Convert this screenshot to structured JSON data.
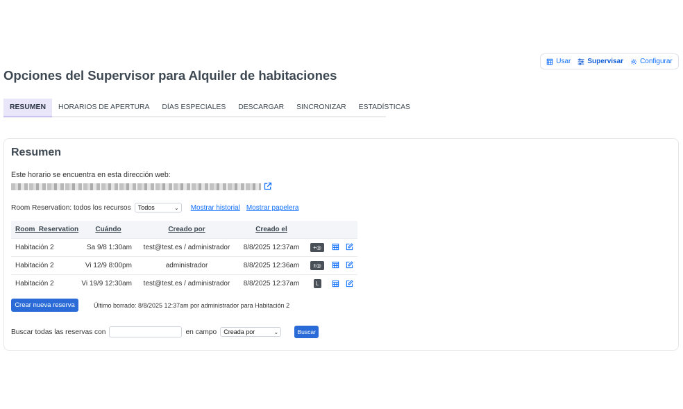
{
  "topnav": {
    "use": "Usar",
    "supervise": "Supervisar",
    "configure": "Configurar"
  },
  "page_title": "Opciones del Supervisor para Alquiler de habitaciones",
  "tabs": [
    {
      "label": "RESUMEN",
      "active": true
    },
    {
      "label": "HORARIOS DE APERTURA"
    },
    {
      "label": "DÍAS ESPECIALES"
    },
    {
      "label": "DESCARGAR"
    },
    {
      "label": "SINCRONIZAR"
    },
    {
      "label": "ESTADÍSTICAS"
    }
  ],
  "card": {
    "title": "Resumen",
    "web_intro": "Este horario se encuentra en esta dirección web:",
    "filter": {
      "label": "Room Reservation: todos los recursos",
      "selected": "Todos",
      "show_history": "Mostrar historial",
      "show_trash": "Mostrar papelera"
    },
    "table": {
      "headers": [
        "Room_Reservation",
        "Cuándo",
        "Creado por",
        "Creado el"
      ],
      "rows": [
        {
          "resource": "Habitación 2",
          "when": "Sa 9/8 1:30am",
          "created_by": "test@test.es / administrador",
          "created_at": "8/8/2025 12:37am",
          "badge": "+◎"
        },
        {
          "resource": "Habitación 2",
          "when": "Vi 12/9 8:00pm",
          "created_by": "administrador",
          "created_at": "8/8/2025 12:36am",
          "badge": "±◎"
        },
        {
          "resource": "Habitación 2",
          "when": "Vi 19/9 12:30am",
          "created_by": "test@test.es / administrador",
          "created_at": "8/8/2025 12:37am",
          "badge": "L"
        }
      ]
    },
    "new_reservation": "Crear nueva reserva",
    "last_deleted": "Último borrado: 8/8/2025 12:37am por administrador para Habitación 2",
    "search": {
      "label": "Buscar todas las reservas con",
      "input_value": "",
      "field_label": "en campo",
      "field_selected": "Creada por",
      "button": "Buscar"
    }
  },
  "colors": {
    "accent": "#0d6efd",
    "primary_button": "#2a6bd8",
    "active_tab_bg": "#e8e6f8",
    "badge_bg": "#495057"
  }
}
